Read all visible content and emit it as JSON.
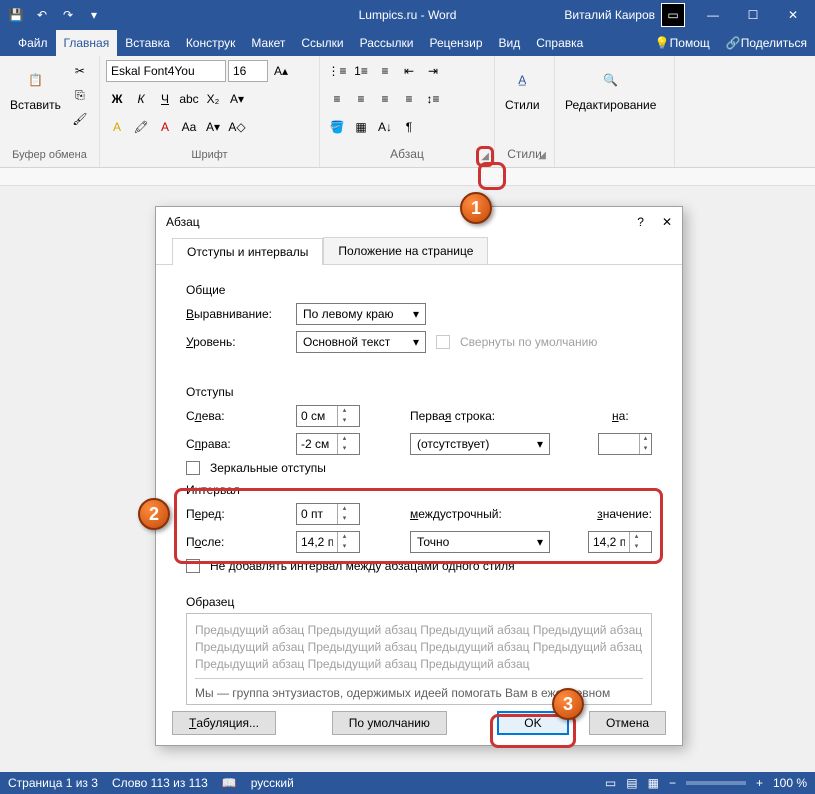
{
  "title": "Lumpics.ru - Word",
  "user": "Виталий Каиров",
  "tabs": [
    "Файл",
    "Главная",
    "Вставка",
    "Конструк",
    "Макет",
    "Ссылки",
    "Рассылки",
    "Рецензир",
    "Вид",
    "Справка"
  ],
  "tabs_right": {
    "tell": "Помощ",
    "share": "Поделиться"
  },
  "ribbon": {
    "clipboard": {
      "paste": "Вставить",
      "label": "Буфер обмена"
    },
    "font": {
      "name": "Eskal Font4You",
      "size": "16",
      "label": "Шрифт"
    },
    "paragraph": {
      "label": "Абзац"
    },
    "styles": {
      "label": "Стили",
      "btn": "Стили"
    },
    "editing": {
      "label": "Редактирование"
    }
  },
  "dialog": {
    "title": "Абзац",
    "tabs": [
      "Отступы и интервалы",
      "Положение на странице"
    ],
    "general": {
      "label": "Общие",
      "alignment_label": "Выравнивание:",
      "alignment_value": "По левому краю",
      "outline_label": "Уровень:",
      "outline_value": "Основной текст",
      "collapsed_label": "Свернуты по умолчанию"
    },
    "indentation": {
      "label": "Отступы",
      "left_label": "Слева:",
      "left_value": "0 см",
      "right_label": "Справа:",
      "right_value": "-2 см",
      "special_label": "Первая строка:",
      "special_value": "(отсутствует)",
      "by_label": "на:",
      "mirror_label": "Зеркальные отступы"
    },
    "spacing": {
      "label": "Интервал",
      "before_label": "Перед:",
      "before_value": "0 пт",
      "after_label": "После:",
      "after_value": "14,2 пт",
      "line_label": "междустрочный:",
      "line_value": "Точно",
      "at_label": "значение:",
      "at_value": "14,2 пт",
      "nospace_label": "Не добавлять интервал между абзацами одного стиля"
    },
    "preview": {
      "label": "Образец",
      "line1": "Предыдущий абзац Предыдущий абзац Предыдущий абзац Предыдущий абзац Предыдущий абзац Предыдущий абзац Предыдущий абзац Предыдущий абзац Предыдущий абзац Предыдущий абзац Предыдущий абзац",
      "line2": "Мы — группа энтузиастов, одержимых идеей помогать Вам в ежедневном контакте с компьютерами и мобильными устройствами. Мы знаем, что в интернете уже полно информации о решении разного рода проблем с ними. Но это не останавливает нас, чтобы рассказывать Вам"
    },
    "buttons": {
      "tabs": "Табуляция...",
      "default": "По умолчанию",
      "ok": "OK",
      "cancel": "Отмена"
    }
  },
  "status": {
    "page": "Страница 1 из 3",
    "words": "Слово 113 из 113",
    "lang": "русский",
    "zoom": "100 %"
  },
  "steps": {
    "s1": "1",
    "s2": "2",
    "s3": "3"
  }
}
